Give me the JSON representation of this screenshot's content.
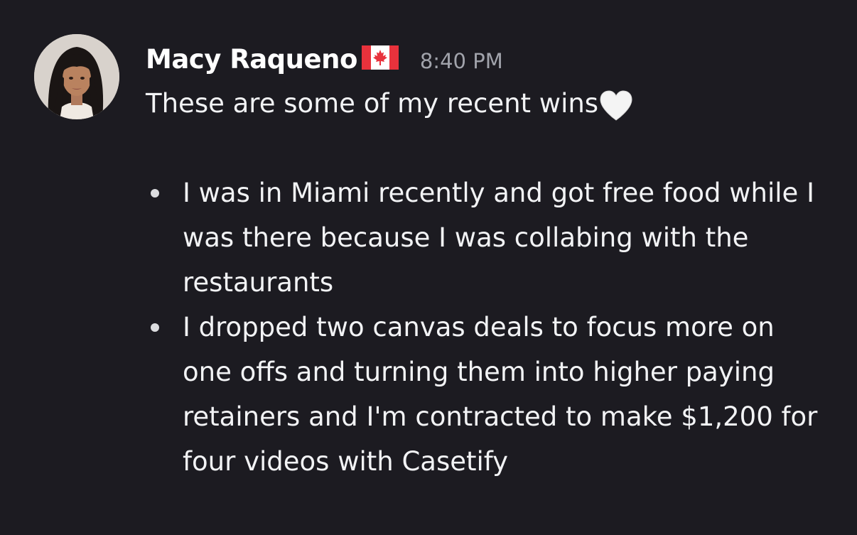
{
  "message": {
    "author": "Macy Raqueno",
    "author_flag_icon": "canada-flag-icon",
    "timestamp": "8:40 PM",
    "intro_text": "These are some of my recent wins",
    "intro_emoji_icon": "white-heart-icon",
    "bullets": [
      {
        "text": "I was in Miami recently and got free food while I was there because I was collabing with the restaurants"
      },
      {
        "text": "I dropped two canvas deals to focus more on one offs and turning them into higher paying retainers and I'm contracted to make $1,200 for four videos with Casetify"
      }
    ]
  },
  "colors": {
    "background": "#1c1b21",
    "text": "#f2f3f5",
    "username": "#ffffff",
    "timestamp": "#a1a3ab",
    "flag_red": "#e8323c"
  }
}
